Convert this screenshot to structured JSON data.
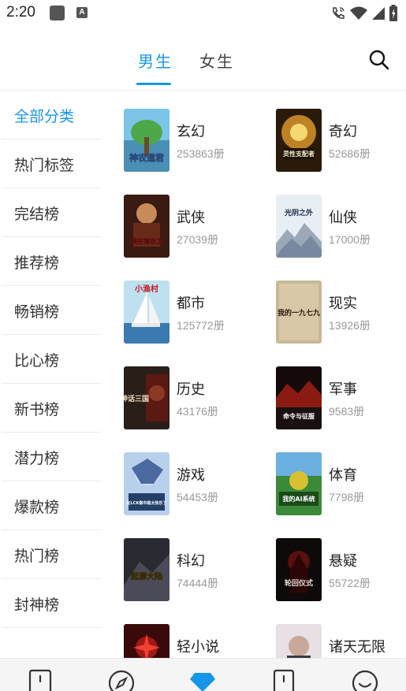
{
  "status_bar": {
    "time": "2:20",
    "icons": [
      "square-icon",
      "a-badge-icon",
      "wifi-call-icon",
      "wifi-icon",
      "signal-icon",
      "battery-icon"
    ],
    "a_badge": "A"
  },
  "header": {
    "tabs": [
      {
        "label": "男生",
        "active": true
      },
      {
        "label": "女生",
        "active": false
      }
    ],
    "search_icon": "search-icon",
    "accent_color": "#1596e8"
  },
  "sidebar": {
    "items": [
      {
        "label": "全部分类",
        "active": true
      },
      {
        "label": "热门标签",
        "active": false
      },
      {
        "label": "完结榜",
        "active": false
      },
      {
        "label": "推荐榜",
        "active": false
      },
      {
        "label": "畅销榜",
        "active": false
      },
      {
        "label": "比心榜",
        "active": false
      },
      {
        "label": "新书榜",
        "active": false
      },
      {
        "label": "潜力榜",
        "active": false
      },
      {
        "label": "爆款榜",
        "active": false
      },
      {
        "label": "热门榜",
        "active": false
      },
      {
        "label": "封神榜",
        "active": false
      }
    ]
  },
  "categories": [
    {
      "name": "玄幻",
      "count": "253863册",
      "cover_text": "神农道君"
    },
    {
      "name": "奇幻",
      "count": "52686册",
      "cover_text": "灵性支配者"
    },
    {
      "name": "武侠",
      "count": "27039册",
      "cover_text": "我在锦衣卫"
    },
    {
      "name": "仙侠",
      "count": "17000册",
      "cover_text": "光阴之外"
    },
    {
      "name": "都市",
      "count": "125772册",
      "cover_text": "小渔村"
    },
    {
      "name": "现实",
      "count": "13926册",
      "cover_text": "我的一九七九"
    },
    {
      "name": "历史",
      "count": "43176册",
      "cover_text": "神话三国"
    },
    {
      "name": "军事",
      "count": "9583册",
      "cover_text": "命令与征服"
    },
    {
      "name": "游戏",
      "count": "54453册",
      "cover_text": "在LCK做中路太快乐了"
    },
    {
      "name": "体育",
      "count": "7798册",
      "cover_text": "我的AI系统"
    },
    {
      "name": "科幻",
      "count": "74444册",
      "cover_text": "起源大陆"
    },
    {
      "name": "悬疑",
      "count": "55722册",
      "cover_text": "轮回仪式"
    },
    {
      "name": "轻小说",
      "count": "",
      "cover_text": ""
    },
    {
      "name": "诸天无限",
      "count": "",
      "cover_text": ""
    }
  ],
  "bottom_nav": {
    "items": [
      {
        "icon": "bookshelf-icon",
        "active": false
      },
      {
        "icon": "discover-compass-icon",
        "active": false
      },
      {
        "icon": "bookstore-diamond-icon",
        "active": true
      },
      {
        "icon": "notice-card-icon",
        "active": false
      },
      {
        "icon": "profile-smile-icon",
        "active": false
      }
    ]
  }
}
